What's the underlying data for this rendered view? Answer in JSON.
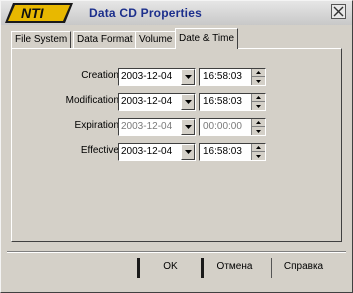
{
  "window": {
    "title": "Data CD Properties",
    "logo_text": "NTI"
  },
  "tabs": [
    {
      "label": "File System",
      "active": false
    },
    {
      "label": "Data Format",
      "active": false
    },
    {
      "label": "Volume",
      "active": false
    },
    {
      "label": "Date & Time",
      "active": true
    }
  ],
  "rows": [
    {
      "label": "Creation",
      "date": "2003-12-04",
      "time": "16:58:03",
      "enabled": true
    },
    {
      "label": "Modification",
      "date": "2003-12-04",
      "time": "16:58:03",
      "enabled": true
    },
    {
      "label": "Expiration",
      "date": "2003-12-04",
      "time": "00:00:00",
      "enabled": false
    },
    {
      "label": "Effective",
      "date": "2003-12-04",
      "time": "16:58:03",
      "enabled": true
    }
  ],
  "buttons": {
    "ok": "OK",
    "cancel": "Отмена",
    "help": "Справка"
  },
  "colors": {
    "title_text": "#1c2f8c",
    "logo_fill": "#e8b800",
    "face": "#d4d0c8"
  }
}
